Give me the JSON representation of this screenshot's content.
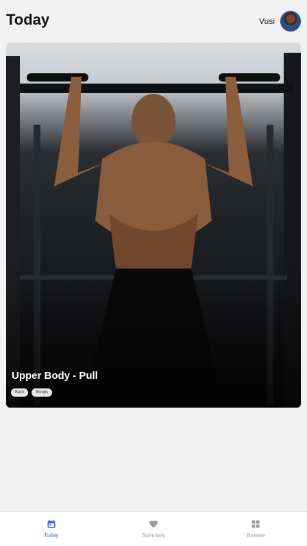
{
  "header": {
    "title": "Today",
    "user_name": "Vusi"
  },
  "workout_card": {
    "title": "Upper Body - Pull",
    "tags": [
      "Back",
      "Biceps"
    ]
  },
  "tabbar": {
    "tabs": [
      {
        "label": "Today",
        "icon": "calendar-icon",
        "active": true
      },
      {
        "label": "Summary",
        "icon": "heart-icon",
        "active": false
      },
      {
        "label": "Browse",
        "icon": "grid-icon",
        "active": false
      }
    ]
  },
  "colors": {
    "accent": "#2f6fdd",
    "inactive": "#9b9b9b",
    "background": "#f2f2f2"
  }
}
